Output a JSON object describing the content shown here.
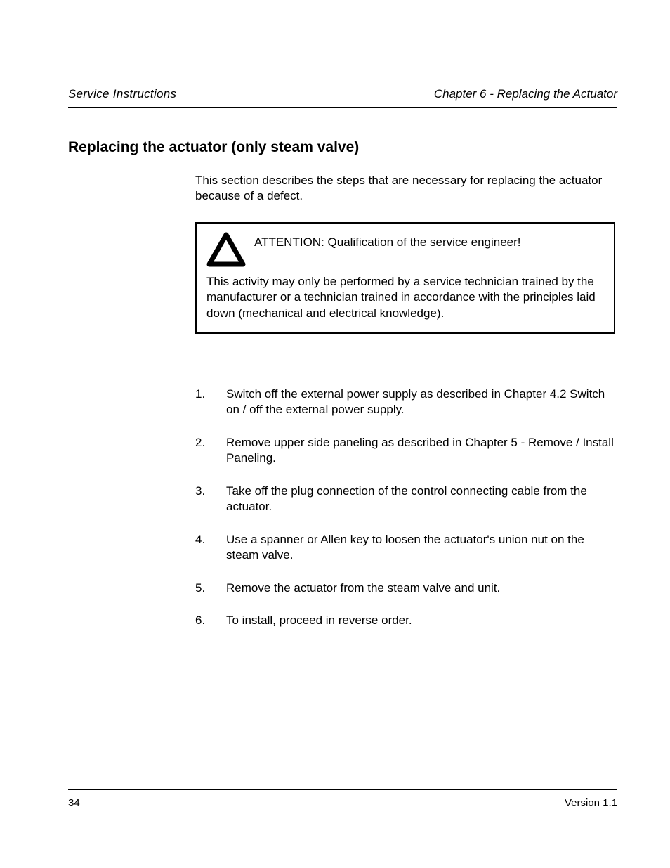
{
  "header": {
    "left": "Service Instructions",
    "right": "Chapter 6 - Replacing the Actuator"
  },
  "section_title": "Replacing the actuator (only steam valve)",
  "intro": "This section describes the steps that are necessary for replacing the actuator because of a defect.",
  "attention": {
    "label": "ATTENTION: ",
    "head_text": "Qualification of the service engineer!",
    "body": "This activity may only be performed by a service technician trained by the manufacturer or a technician trained in accordance with the principles laid down (mechanical and electrical knowledge)."
  },
  "steps": [
    {
      "num": "1.",
      "text": "Switch off the external power supply as described in Chapter 4.2 Switch on / off the external power supply."
    },
    {
      "num": "2.",
      "text": "Remove upper side paneling as described in Chapter 5 - Remove / Install Paneling."
    },
    {
      "num": "3.",
      "text": "Take off the plug connection of the control connecting cable from the actuator."
    },
    {
      "num": "4.",
      "text": "Use a spanner or Allen key to loosen the actuator's union nut on the steam valve."
    },
    {
      "num": "5.",
      "text": "Remove the actuator from the steam valve and unit."
    },
    {
      "num": "6.",
      "text": "To install, proceed in reverse order."
    }
  ],
  "footer": {
    "left": "34",
    "right": "Version 1.1"
  }
}
